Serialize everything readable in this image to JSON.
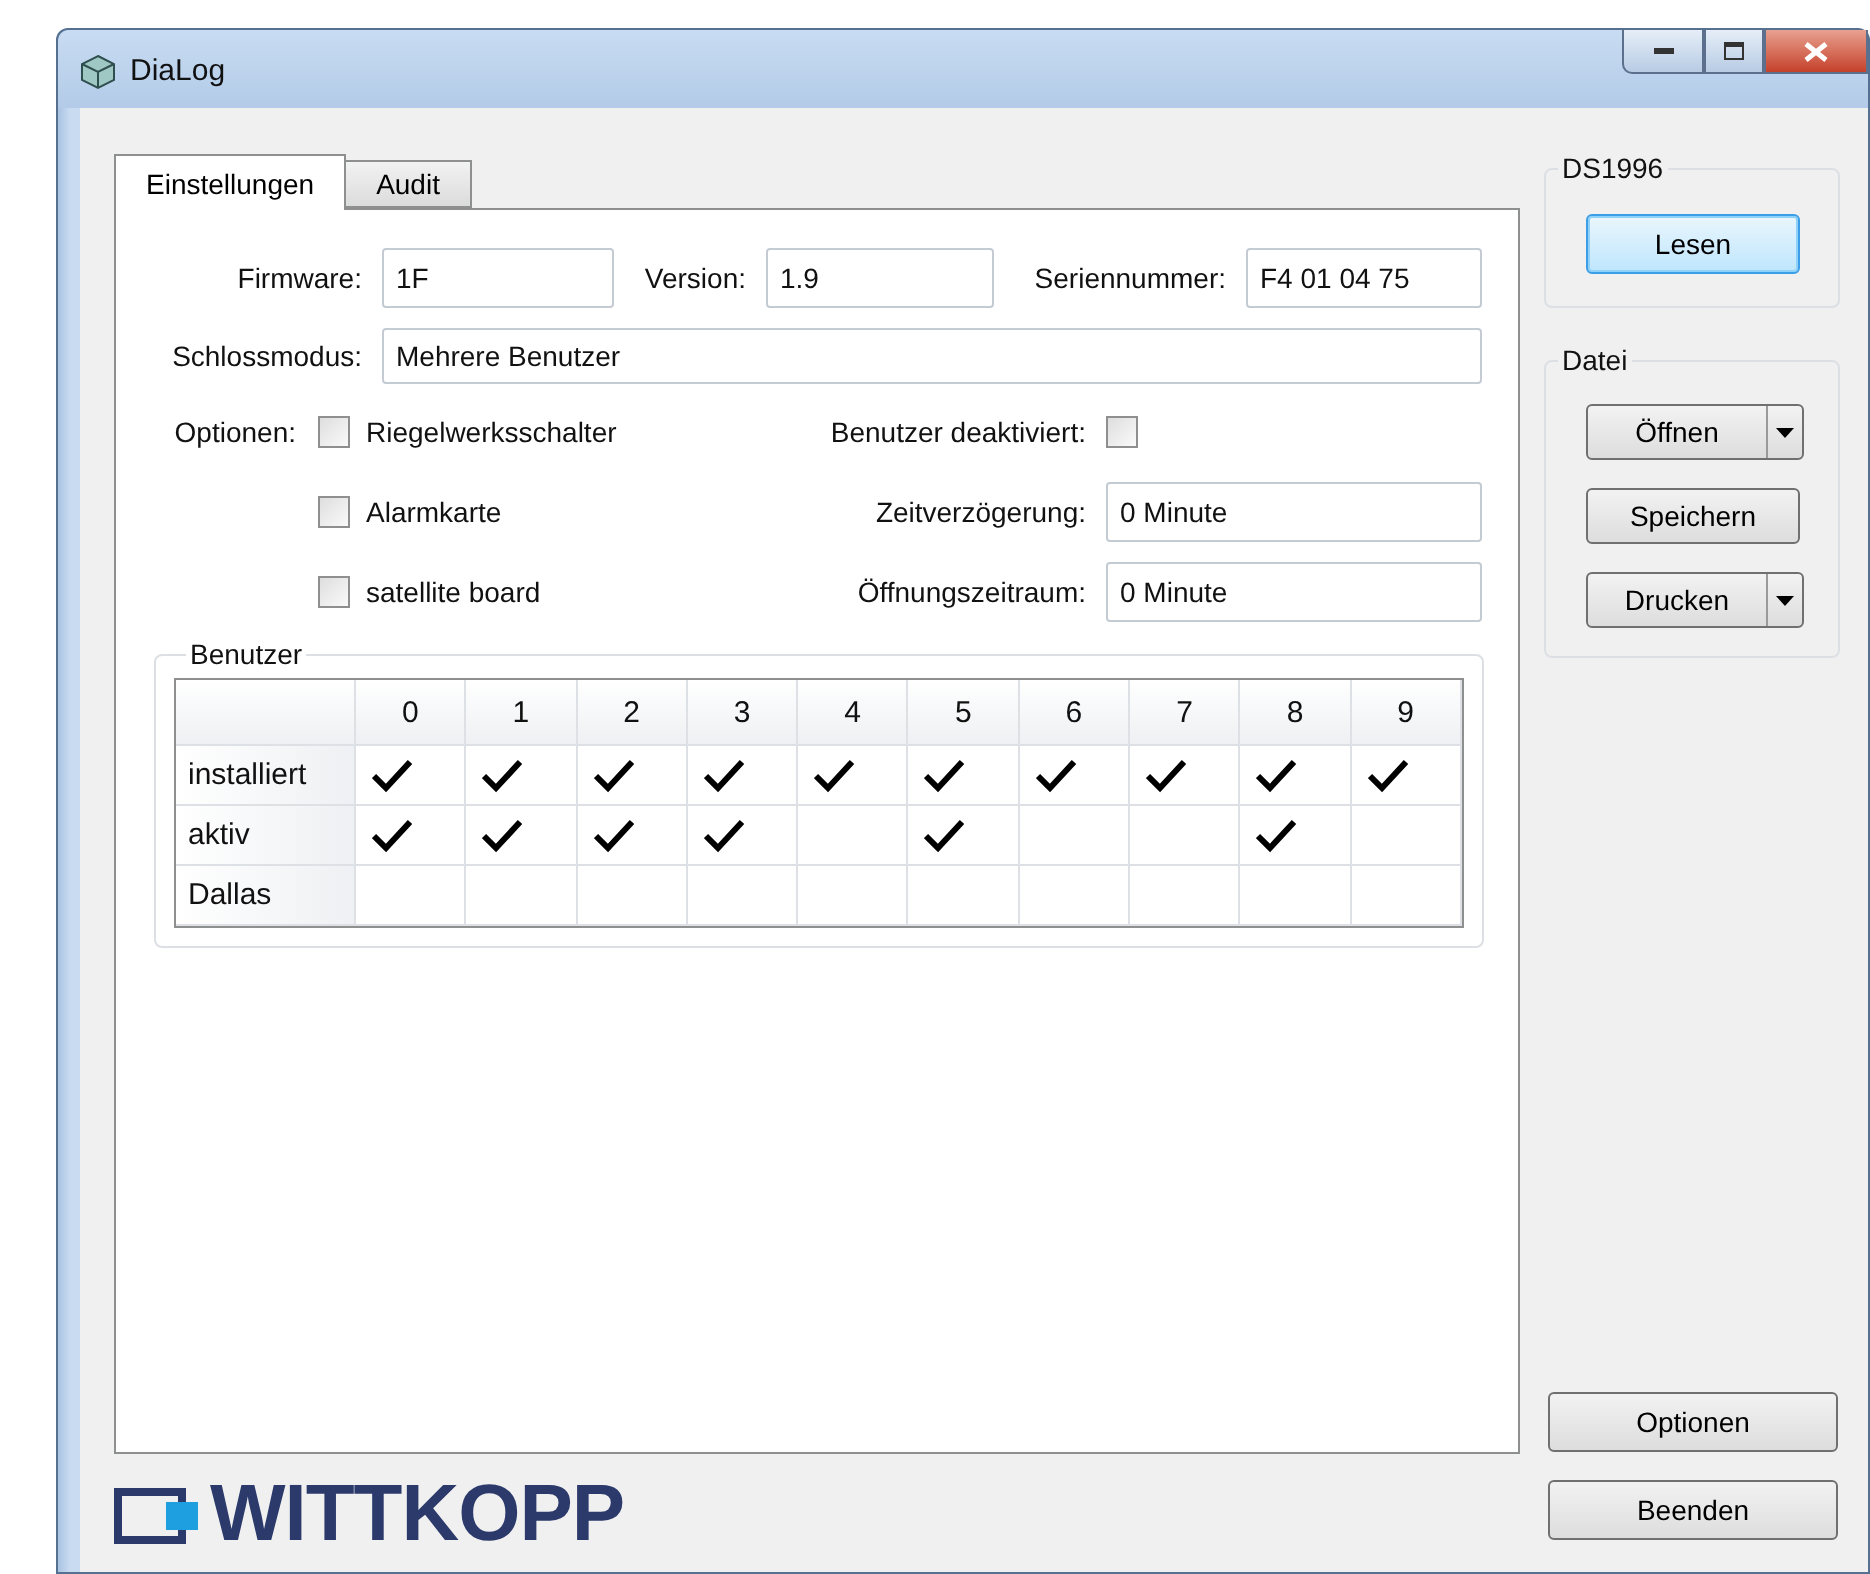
{
  "window": {
    "title": "DiaLog"
  },
  "tabs": [
    {
      "label": "Einstellungen",
      "selected": true
    },
    {
      "label": "Audit",
      "selected": false
    }
  ],
  "firmware": {
    "label": "Firmware:",
    "value": "1F"
  },
  "version": {
    "label": "Version:",
    "value": "1.9"
  },
  "serial": {
    "label": "Seriennummer:",
    "value": "F4 01 04 75"
  },
  "lock_mode": {
    "label": "Schlossmodus:",
    "value": "Mehrere Benutzer"
  },
  "options_label": "Optionen:",
  "options": [
    {
      "label": "Riegelwerksschalter",
      "checked": false
    },
    {
      "label": "Alarmkarte",
      "checked": false
    },
    {
      "label": "satellite board",
      "checked": false
    }
  ],
  "user_disabled": {
    "label": "Benutzer deaktiviert:",
    "checked": false
  },
  "time_delay": {
    "label": "Zeitverzögerung:",
    "value": "0 Minute"
  },
  "opening_period": {
    "label": "Öffnungszeitraum:",
    "value": "0 Minute"
  },
  "users": {
    "title": "Benutzer",
    "columns": [
      "0",
      "1",
      "2",
      "3",
      "4",
      "5",
      "6",
      "7",
      "8",
      "9"
    ],
    "rows": [
      {
        "label": "installiert",
        "cells": [
          true,
          true,
          true,
          true,
          true,
          true,
          true,
          true,
          true,
          true
        ]
      },
      {
        "label": "aktiv",
        "cells": [
          true,
          true,
          true,
          true,
          false,
          true,
          false,
          false,
          true,
          false
        ]
      },
      {
        "label": "Dallas",
        "cells": [
          false,
          false,
          false,
          false,
          false,
          false,
          false,
          false,
          false,
          false
        ]
      }
    ]
  },
  "logo": {
    "text": "WITTKOPP"
  },
  "groups": [
    {
      "title": "DS1996",
      "buttons": [
        {
          "label": "Lesen",
          "kind": "focused"
        }
      ]
    },
    {
      "title": "Datei",
      "buttons": [
        {
          "label": "Öffnen",
          "kind": "split"
        },
        {
          "label": "Speichern",
          "kind": "plain"
        },
        {
          "label": "Drucken",
          "kind": "split"
        }
      ]
    }
  ],
  "bottom_buttons": [
    {
      "label": "Optionen"
    },
    {
      "label": "Beenden"
    }
  ]
}
